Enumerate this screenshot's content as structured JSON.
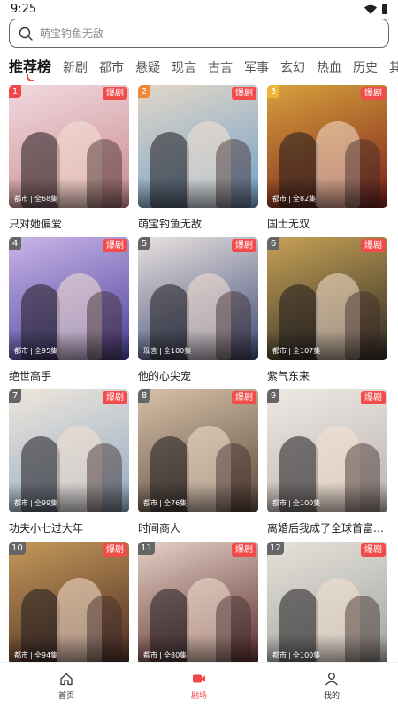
{
  "status": {
    "time": "9:25"
  },
  "search": {
    "placeholder": "萌宝钓鱼无敌"
  },
  "tabs": [
    "推荐榜",
    "新剧",
    "都市",
    "悬疑",
    "现言",
    "古言",
    "军事",
    "玄幻",
    "热血",
    "历史",
    "其"
  ],
  "badge_label": "爆剧",
  "dramas": [
    {
      "rank": "1",
      "title": "只对她偏爱",
      "genre": "都市",
      "episodes": "全68集",
      "colors": [
        "#c98a8e",
        "#f1d9df"
      ]
    },
    {
      "rank": "2",
      "title": "萌宝钓鱼无敌",
      "genre": "",
      "episodes": "",
      "colors": [
        "#6f9fc8",
        "#e3d7c8"
      ]
    },
    {
      "rank": "3",
      "title": "国士无双",
      "genre": "都市",
      "episodes": "全82集",
      "colors": [
        "#7a1e1a",
        "#d8a13c"
      ]
    },
    {
      "rank": "4",
      "title": "绝世高手",
      "genre": "都市",
      "episodes": "全95集",
      "colors": [
        "#4a3f9a",
        "#c9b6e8"
      ]
    },
    {
      "rank": "5",
      "title": "他的心尖宠",
      "genre": "现言",
      "episodes": "全100集",
      "colors": [
        "#3c4a78",
        "#e9e1de"
      ]
    },
    {
      "rank": "6",
      "title": "紫气东来",
      "genre": "都市",
      "episodes": "全107集",
      "colors": [
        "#2c2a24",
        "#c8a256"
      ]
    },
    {
      "rank": "7",
      "title": "功夫小七过大年",
      "genre": "都市",
      "episodes": "全99集",
      "colors": [
        "#8fa9c2",
        "#efe6dc"
      ]
    },
    {
      "rank": "8",
      "title": "时间商人",
      "genre": "都市",
      "episodes": "全76集",
      "colors": [
        "#5b4a3c",
        "#d7c2a8"
      ]
    },
    {
      "rank": "9",
      "title": "离婚后我成了全球首富的外孙女",
      "genre": "都市",
      "episodes": "全100集",
      "colors": [
        "#b9b2ad",
        "#efe9e4"
      ]
    },
    {
      "rank": "10",
      "title": "",
      "genre": "都市",
      "episodes": "全94集",
      "colors": [
        "#4a2a22",
        "#c59a5a"
      ]
    },
    {
      "rank": "11",
      "title": "",
      "genre": "都市",
      "episodes": "全80集",
      "colors": [
        "#5a2c2e",
        "#e6d2c6"
      ]
    },
    {
      "rank": "12",
      "title": "",
      "genre": "都市",
      "episodes": "全100集",
      "colors": [
        "#9fa4a0",
        "#e7e2da"
      ]
    }
  ],
  "bottom_nav": [
    {
      "label": "首页",
      "icon": "home-icon",
      "active": false
    },
    {
      "label": "剧场",
      "icon": "video-icon",
      "active": true
    },
    {
      "label": "我的",
      "icon": "user-icon",
      "active": false
    }
  ],
  "colors": {
    "accent": "#f04848",
    "badge": "#f24b4b"
  }
}
